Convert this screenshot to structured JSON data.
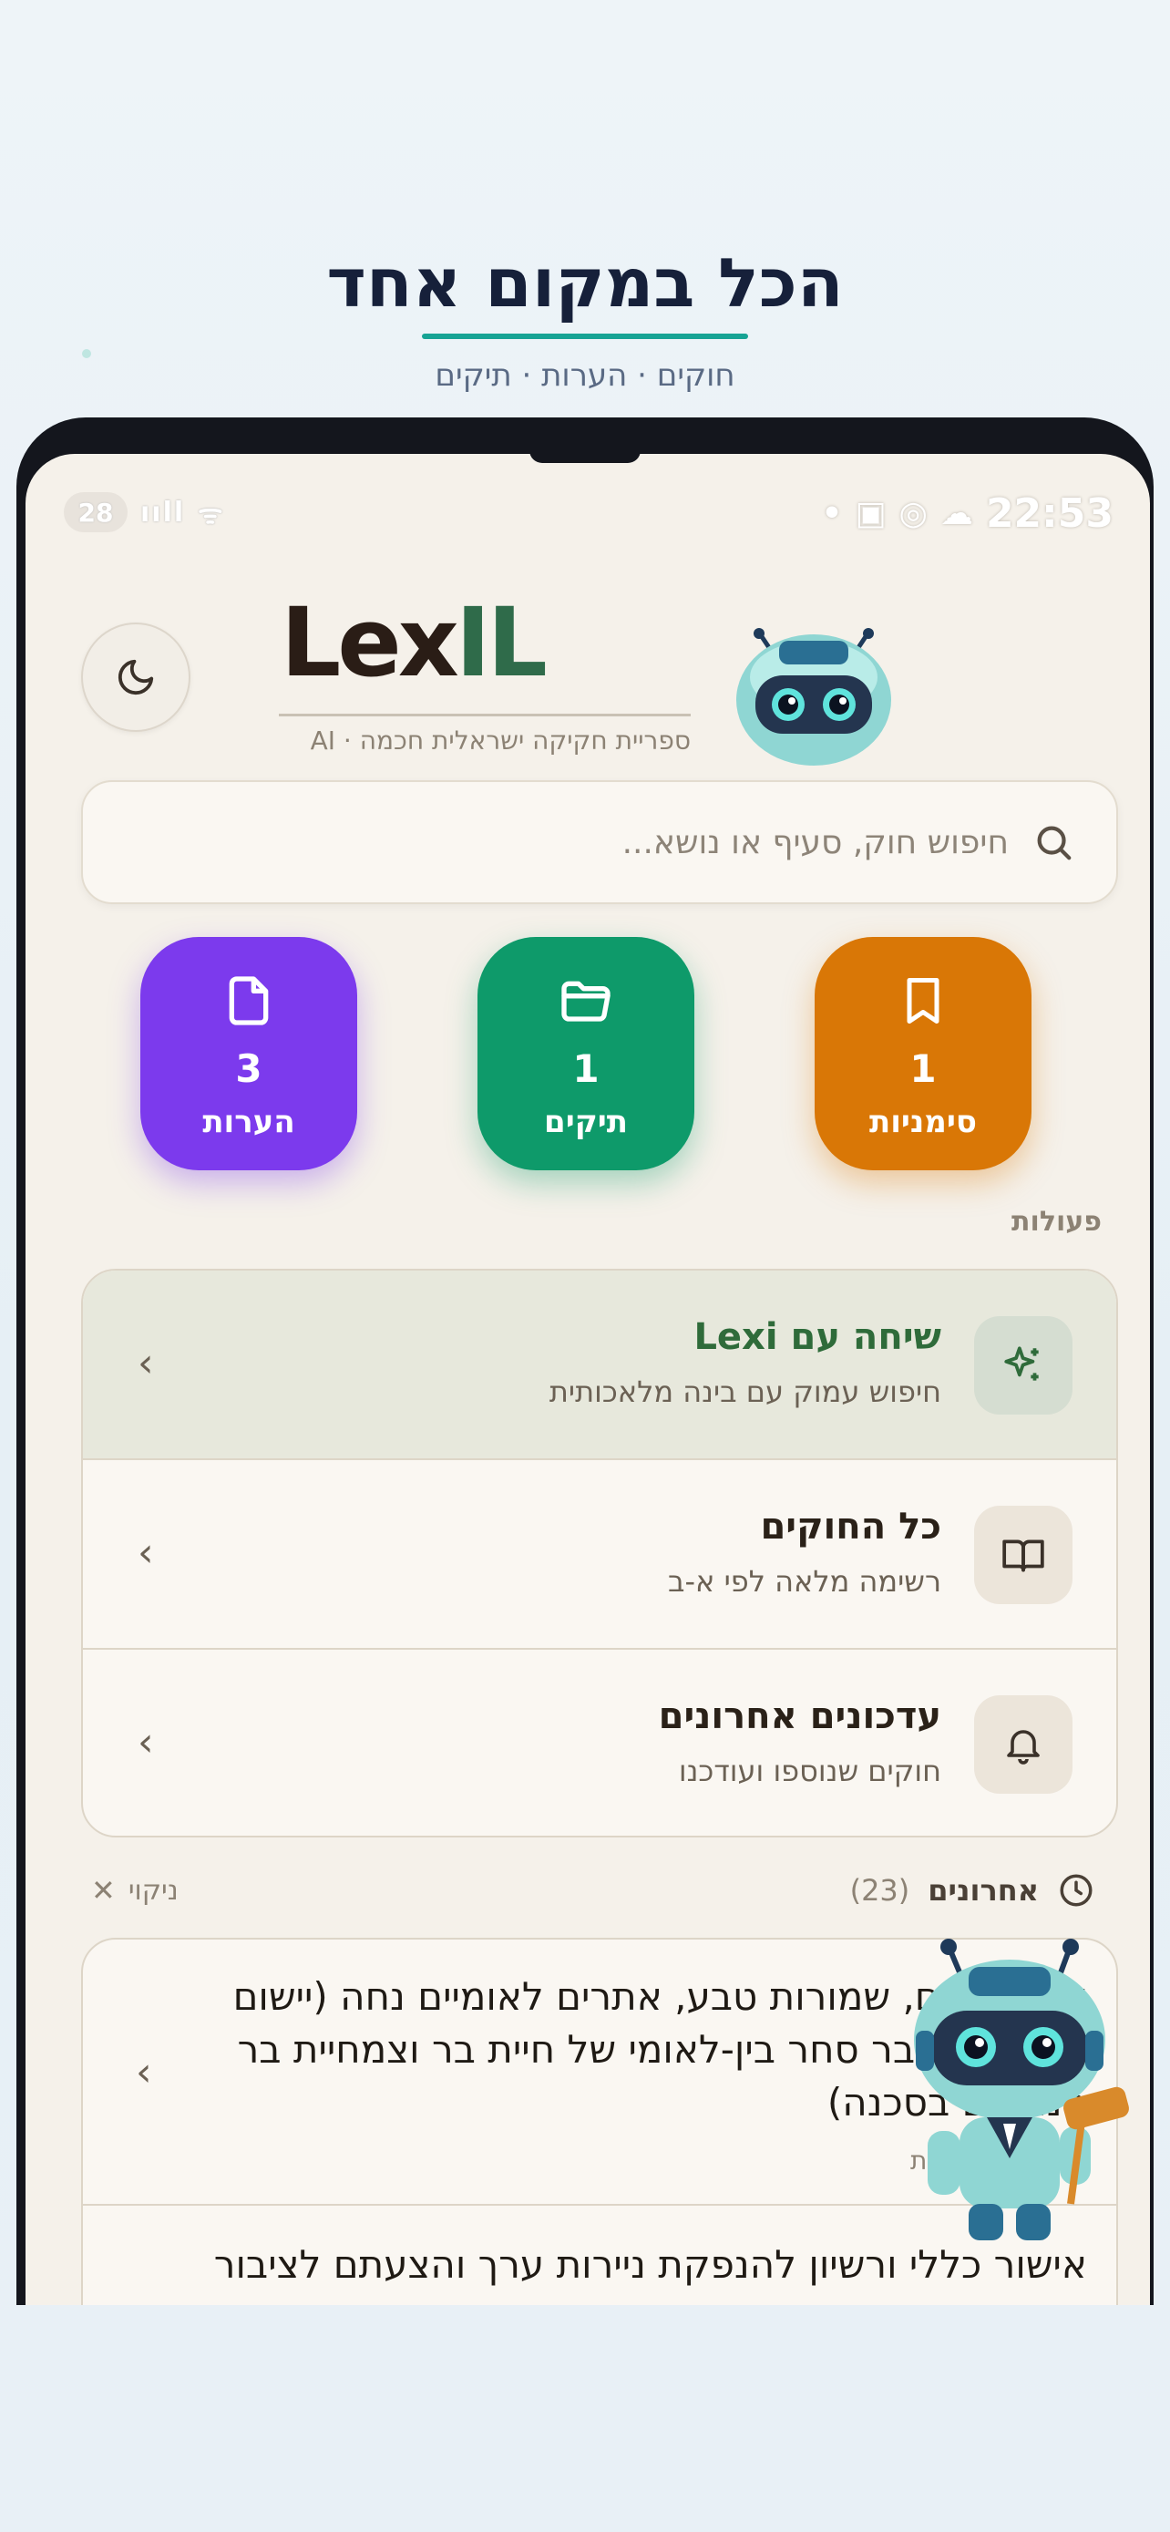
{
  "hero": {
    "title": "הכל במקום אחד",
    "subtitle": "חוקים · הערות · תיקים"
  },
  "status_bar": {
    "battery": "28",
    "time": "22:53"
  },
  "app": {
    "logo_text": "LexIL",
    "tagline": "ספריית חקיקה ישראלית חכמה · AI",
    "search_placeholder": "חיפוש חוק, סעיף או נושא..."
  },
  "stats": [
    {
      "label": "סימניות",
      "count": "1",
      "icon": "bookmark-icon",
      "color": "#d97706"
    },
    {
      "label": "תיקים",
      "count": "1",
      "icon": "folder-icon",
      "color": "#0e9a6a"
    },
    {
      "label": "הערות",
      "count": "3",
      "icon": "file-icon",
      "color": "#7c3aed"
    }
  ],
  "actions_label": "פעולות",
  "actions": [
    {
      "title": "שיחה עם Lexi",
      "subtitle": "חיפוש עמוק עם בינה מלאכותית",
      "icon": "sparkles-icon",
      "active": true
    },
    {
      "title": "כל החוקים",
      "subtitle": "רשימה מלאה לפי א-ב",
      "icon": "book-open-icon",
      "active": false
    },
    {
      "title": "עדכונים אחרונים",
      "subtitle": "חוקים שנוספו ועודכנו",
      "icon": "bell-icon",
      "active": false
    }
  ],
  "recent": {
    "title": "אחרונים",
    "count": "(23)",
    "clear_label": "ניקוי",
    "items": [
      {
        "text": "ים לאומיים, שמורות טבע, אתרים לאומיים נחה (יישום האמנה בדבר סחר בין-לאומי של חיית בר וצמחיית בר הנתונים בסכנה)",
        "meta": "ות"
      },
      {
        "text": "אישור כללי ורשיון להנפקת ניירות ערך והצעתם לציבור"
      }
    ]
  },
  "colors": {
    "accent_green": "#2f6b3a",
    "logo_dark": "#2a1d16",
    "logo_green": "#2f6b4a"
  }
}
